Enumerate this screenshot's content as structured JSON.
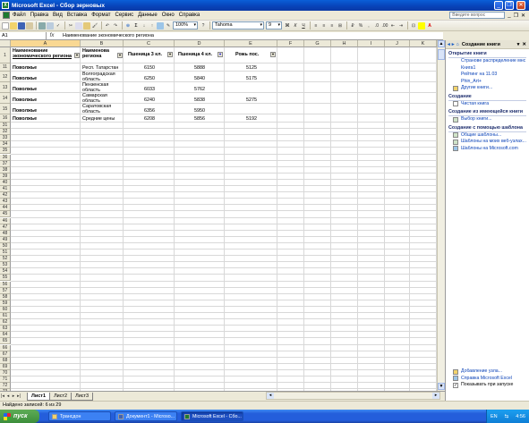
{
  "window": {
    "title": "Microsoft Excel - Сбор зерновых"
  },
  "menu": [
    "Файл",
    "Правка",
    "Вид",
    "Вставка",
    "Формат",
    "Сервис",
    "Данные",
    "Окно",
    "Справка"
  ],
  "help_placeholder": "Введите вопрос",
  "toolbar": {
    "zoom": "100%",
    "font": "Tahoma",
    "font_size": "9"
  },
  "formula_bar": {
    "name_box": "A1",
    "fx": "fx",
    "content": "Наименование экономического региона"
  },
  "columns": [
    "A",
    "B",
    "C",
    "D",
    "E",
    "F",
    "G",
    "H",
    "I",
    "J",
    "K"
  ],
  "rows": {
    "visible_numbers": [
      "1",
      "11",
      "12",
      "13",
      "14",
      "15",
      "16",
      "31",
      "32",
      "33",
      "34",
      "35",
      "36",
      "37",
      "38",
      "39",
      "40",
      "41",
      "42",
      "43",
      "44",
      "45",
      "46",
      "47",
      "48",
      "49",
      "50",
      "51",
      "52",
      "53",
      "54",
      "55",
      "56",
      "57",
      "58",
      "59",
      "60",
      "61",
      "62",
      "63",
      "64",
      "65",
      "66",
      "67",
      "68",
      "69",
      "70",
      "71",
      "72",
      "73",
      "74",
      "75",
      "76",
      "77",
      "78",
      "79"
    ]
  },
  "sheet": {
    "header": {
      "a_line1": "Наименование",
      "a_line2": "экономического региона",
      "b_line1": "Наименова",
      "b_line2": "региона",
      "c": "Пшеница 3 кл.",
      "d": "Пшеница 4 кл.",
      "e": "Рожь пос."
    },
    "data": [
      {
        "row": "11",
        "a": "Поволжье",
        "b1": "Респ. Татарстан",
        "b2": "",
        "c": "6150",
        "d": "5888",
        "e": "5125"
      },
      {
        "row": "12",
        "a": "Поволжье",
        "b1": "Волгоградская",
        "b2": "область",
        "c": "6250",
        "d": "5840",
        "e": "5175"
      },
      {
        "row": "13",
        "a": "Поволжье",
        "b1": "Пензенская",
        "b2": "область",
        "c": "6033",
        "d": "5762",
        "e": ""
      },
      {
        "row": "14",
        "a": "Поволжье",
        "b1": "Самарская",
        "b2": "область",
        "c": "6240",
        "d": "5838",
        "e": "5275"
      },
      {
        "row": "15",
        "a": "Поволжье",
        "b1": "Саратовская",
        "b2": "область",
        "c": "6356",
        "d": "5950",
        "e": ""
      },
      {
        "row": "16",
        "a": "Поволжье",
        "b1": "Средние цены",
        "b2": "",
        "c": "6208",
        "d": "5856",
        "e": "5192"
      }
    ]
  },
  "sheet_tabs": [
    "Лист1",
    "Лист2",
    "Лист3"
  ],
  "status": "Найдено записей: 6 из 29",
  "task_pane": {
    "title": "Создание книги",
    "sections": [
      {
        "heading": "Открытие книги",
        "links": [
          "Странове распределение мнс",
          "Книга1",
          "Рейтинг на 11.03",
          "Phin_Art+",
          "Другие книги..."
        ]
      },
      {
        "heading": "Создание",
        "links": [
          "Чистая книга"
        ]
      },
      {
        "heading": "Создание из имеющейся книги",
        "links": [
          "Выбор книги..."
        ]
      },
      {
        "heading": "Создание с помощью шаблона",
        "links": [
          "Общие шаблоны...",
          "Шаблоны на моих веб-узлах...",
          "Шаблоны на Microsoft.com"
        ]
      }
    ],
    "footer": [
      "Добавление узла...",
      "Справка Microsoft Excel",
      "Показывать при запуске"
    ]
  },
  "taskbar": {
    "start": "пуск",
    "tasks": [
      "Трансдон",
      "Документ1 - Microso...",
      "Microsoft Excel - Сбо..."
    ],
    "lang": "EN",
    "clock": "4:56"
  }
}
